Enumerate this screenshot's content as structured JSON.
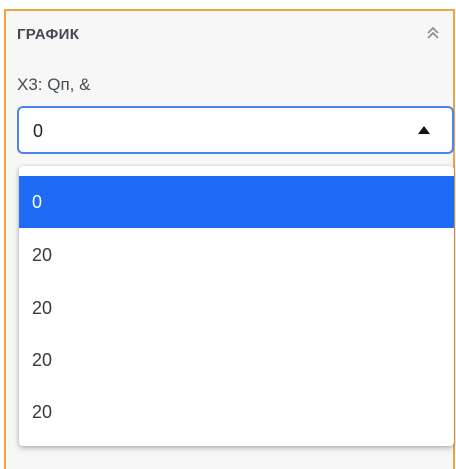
{
  "section": {
    "title": "ГРАФИК",
    "collapse_icon": "double-chevron-up-icon"
  },
  "field": {
    "label": "X3: Qп, &",
    "selected_value": "0"
  },
  "dropdown": {
    "options": [
      {
        "label": "0",
        "selected": true
      },
      {
        "label": "20",
        "selected": false
      },
      {
        "label": "20",
        "selected": false
      },
      {
        "label": "20",
        "selected": false
      },
      {
        "label": "20",
        "selected": false
      }
    ]
  },
  "colors": {
    "frame_border": "#f0a43c",
    "select_border": "#4b83f0",
    "selected_option_bg": "#1f6bf6"
  }
}
